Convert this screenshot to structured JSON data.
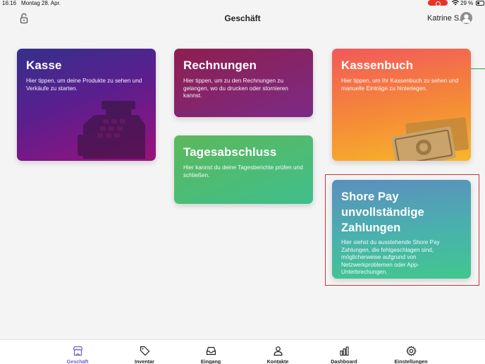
{
  "status_bar": {
    "time": "16:16",
    "date": "Montag 28. Apr.",
    "battery": "29 %"
  },
  "header": {
    "title": "Geschäft",
    "user_name": "Katrine S.",
    "lock_icon": "lock-icon",
    "avatar_icon": "user-avatar-icon"
  },
  "cards": {
    "kasse": {
      "title": "Kasse",
      "description": "Hier tippen, um deine Produkte zu sehen und Verkäufe zu starten.",
      "icon": "cash-register-icon"
    },
    "rechnungen": {
      "title": "Rechnungen",
      "description": "Hier tippen, um zu den Rechnungen zu gelangen, wo du drucken oder stornieren kannst."
    },
    "kassenbuch": {
      "title": "Kassenbuch",
      "description": "Hier tippen, um Ihr Kassenbuch zu sehen und manuelle Einträge zu hinterlegen.",
      "icon": "banknotes-icon"
    },
    "tagesabschluss": {
      "title": "Tagesabschluss",
      "description": "Hier kannst du deine Tagesberichte prüfen und schließen."
    },
    "shore_pay": {
      "title_lines": [
        "Shore Pay",
        "unvollständige",
        "Zahlungen"
      ],
      "description": "Hier siehst du ausstehende Shore Pay Zahlungen, die fehlgeschlagen sind, möglicherweise aufgrund von Netzwerkproblemen oder App-Unterbrechungen."
    }
  },
  "tab_bar": {
    "tabs": [
      {
        "label": "Geschäft",
        "icon": "store-icon",
        "active": true
      },
      {
        "label": "Inventar",
        "icon": "tag-icon",
        "active": false
      },
      {
        "label": "Eingang",
        "icon": "inbox-icon",
        "active": false
      },
      {
        "label": "Kontakte",
        "icon": "person-icon",
        "active": false
      },
      {
        "label": "Dashboard",
        "icon": "bar-chart-icon",
        "active": false
      },
      {
        "label": "Einstellungen",
        "icon": "gear-icon",
        "active": false
      }
    ]
  },
  "colors": {
    "accent": "#6b5fd0",
    "highlight": "#c4353a"
  }
}
